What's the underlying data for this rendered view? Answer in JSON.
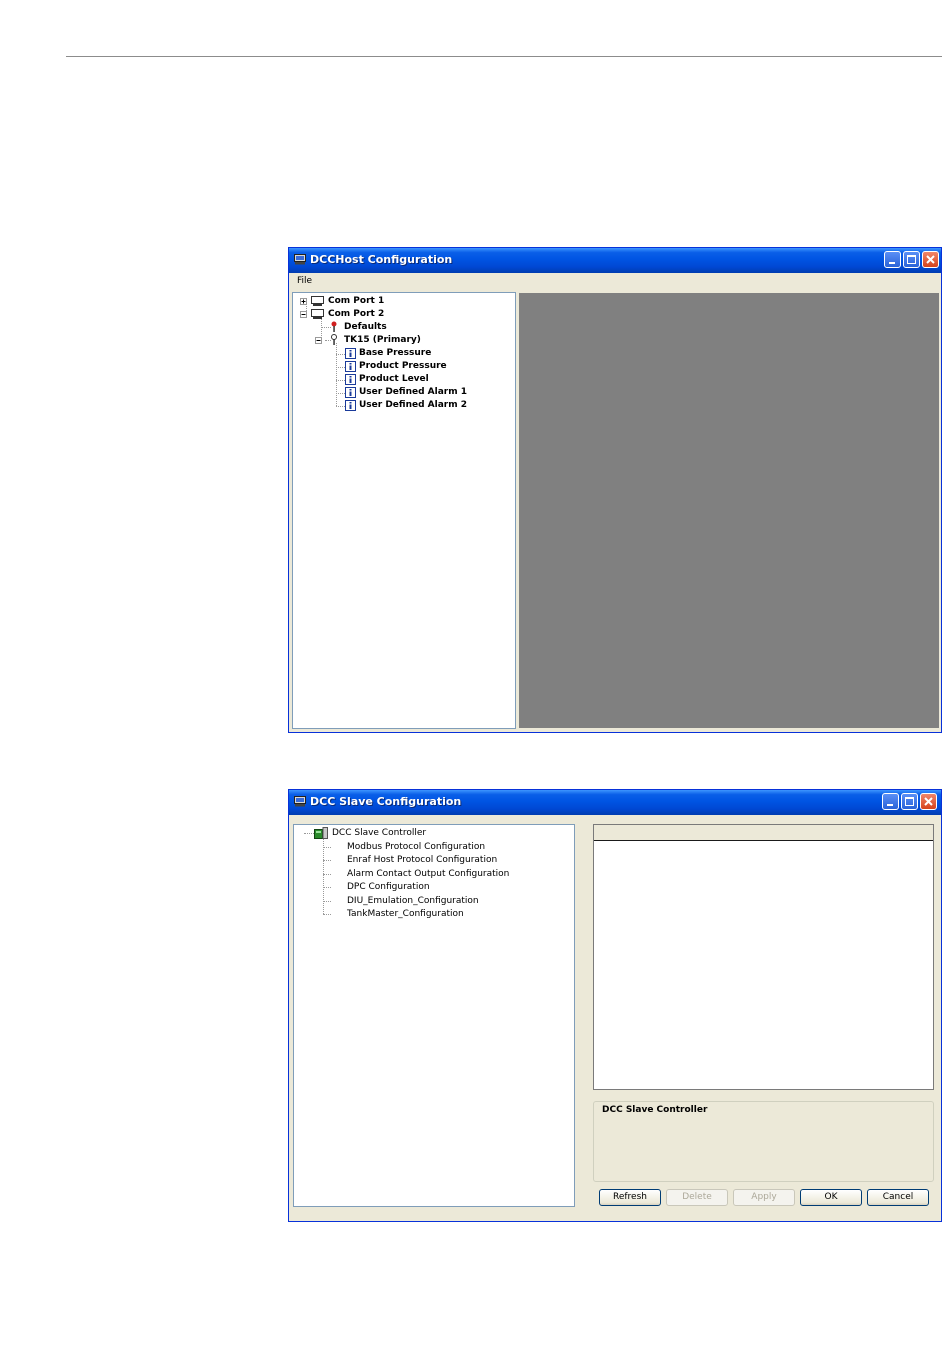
{
  "host_window": {
    "title": "DCCHost Configuration",
    "menu": {
      "file_label": "File"
    },
    "tree": [
      {
        "label": "Com Port 1",
        "expander": "+"
      },
      {
        "label": "Com Port 2",
        "expander": "-"
      },
      {
        "label": "Defaults"
      },
      {
        "label": "TK15 (Primary)",
        "expander": "-"
      },
      {
        "label": "Base Pressure"
      },
      {
        "label": "Product Pressure"
      },
      {
        "label": "Product Level"
      },
      {
        "label": "User Defined Alarm 1"
      },
      {
        "label": "User Defined Alarm 2"
      }
    ]
  },
  "slave_window": {
    "title": "DCC Slave Configuration",
    "tree": [
      {
        "label": "DCC Slave Controller"
      },
      {
        "label": "Modbus Protocol Configuration"
      },
      {
        "label": "Enraf Host Protocol Configuration"
      },
      {
        "label": "Alarm Contact Output Configuration"
      },
      {
        "label": "DPC Configuration"
      },
      {
        "label": "DIU_Emulation_Configuration"
      },
      {
        "label": "TankMaster_Configuration"
      }
    ],
    "description_title": "DCC Slave Controller",
    "buttons": {
      "refresh": "Refresh",
      "delete": "Delete",
      "apply": "Apply",
      "ok": "OK",
      "cancel": "Cancel"
    }
  },
  "colors": {
    "titlebar": "#0054e3",
    "window_face": "#ece9d8",
    "empty_pane": "#808080"
  }
}
